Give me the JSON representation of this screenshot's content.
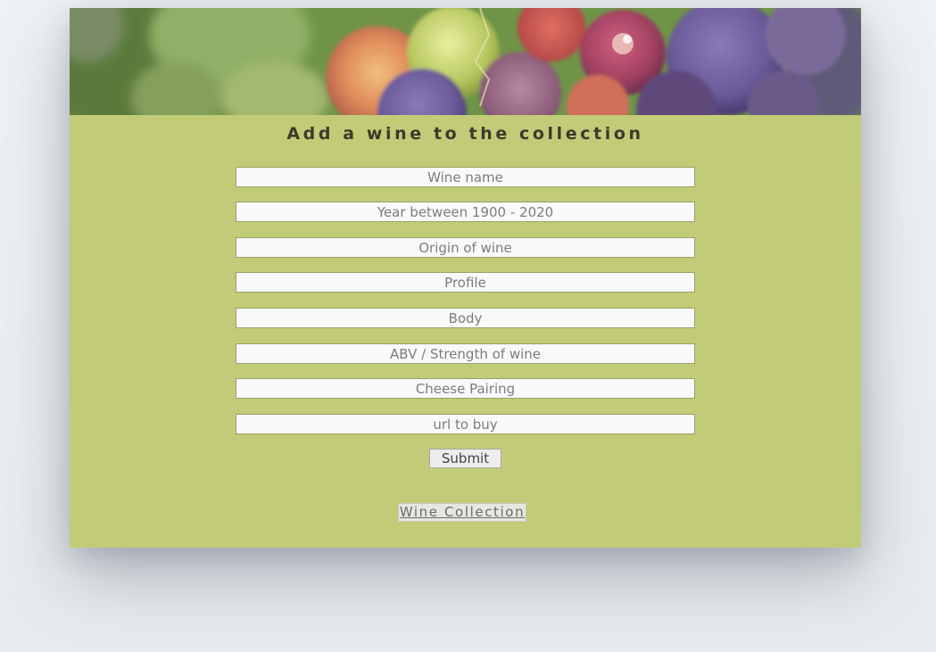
{
  "form": {
    "title": "Add a wine to the collection",
    "fields": [
      {
        "name": "wine-name-field",
        "placeholder": "Wine name"
      },
      {
        "name": "year-field",
        "placeholder": "Year between 1900 - 2020"
      },
      {
        "name": "origin-field",
        "placeholder": "Origin of wine"
      },
      {
        "name": "profile-field",
        "placeholder": "Profile"
      },
      {
        "name": "body-field",
        "placeholder": "Body"
      },
      {
        "name": "abv-field",
        "placeholder": "ABV / Strength of wine"
      },
      {
        "name": "cheese-pairing-field",
        "placeholder": "Cheese Pairing"
      },
      {
        "name": "url-field",
        "placeholder": "url to buy"
      }
    ],
    "submit_label": "Submit"
  },
  "nav": {
    "collection_link": "Wine Collection"
  },
  "colors": {
    "card_background": "#c2cc78",
    "page_background": "#e8edf1"
  },
  "hero": {
    "icon": "grapes-image"
  }
}
